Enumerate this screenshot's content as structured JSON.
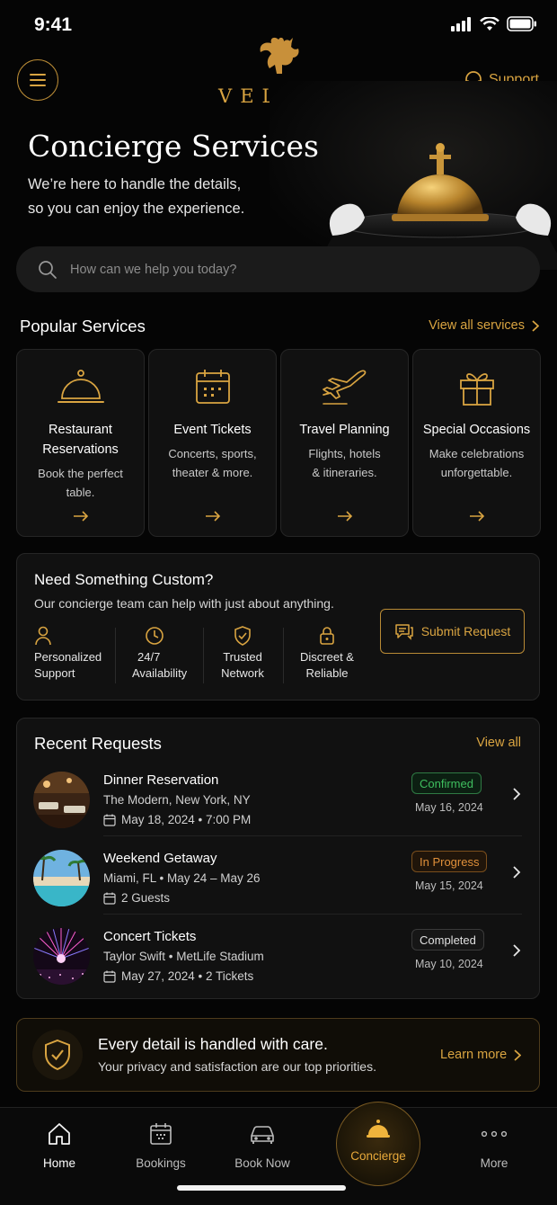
{
  "status": {
    "time": "9:41"
  },
  "brand": {
    "name": "VELTRÉ"
  },
  "header": {
    "support_label": "Support"
  },
  "hero": {
    "title": "Concierge Services",
    "subtitle_line1": "We’re here to handle the details,",
    "subtitle_line2": "so you can enjoy the experience."
  },
  "search": {
    "placeholder": "How can we help you today?"
  },
  "popular": {
    "title": "Popular Services",
    "view_all": "View all services",
    "items": [
      {
        "title_l1": "Restaurant",
        "title_l2": "Reservations",
        "desc_l1": "Book the perfect",
        "desc_l2": "table.",
        "icon": "cloche-icon"
      },
      {
        "title_l1": "Event Tickets",
        "title_l2": "",
        "desc_l1": "Concerts, sports,",
        "desc_l2": "theater & more.",
        "icon": "calendar-icon"
      },
      {
        "title_l1": "Travel Planning",
        "title_l2": "",
        "desc_l1": "Flights, hotels",
        "desc_l2": "& itineraries.",
        "icon": "airplane-icon"
      },
      {
        "title_l1": "Special Occasions",
        "title_l2": "",
        "desc_l1": "Make celebrations",
        "desc_l2": "unforgettable.",
        "icon": "gift-icon"
      }
    ]
  },
  "custom": {
    "title": "Need Something Custom?",
    "subtitle": "Our concierge team can help with just about anything.",
    "features": [
      {
        "l1": "Personalized",
        "l2": "Support",
        "icon": "person-icon"
      },
      {
        "l1": "24/7",
        "l2": "Availability",
        "icon": "clock-icon"
      },
      {
        "l1": "Trusted",
        "l2": "Network",
        "icon": "shield-check-icon"
      },
      {
        "l1": "Discreet &",
        "l2": "Reliable",
        "icon": "lock-icon"
      }
    ],
    "submit_label": "Submit Request"
  },
  "recent": {
    "title": "Recent Requests",
    "view_all": "View all",
    "items": [
      {
        "title": "Dinner Reservation",
        "line1": "The Modern, New York, NY",
        "line2": "May 18, 2024 • 7:00 PM",
        "status": "Confirmed",
        "date": "May 16, 2024",
        "status_color": "#3fbf5f"
      },
      {
        "title": "Weekend Getaway",
        "line1": "Miami, FL • May 24 – May 26",
        "line2": "2 Guests",
        "status": "In Progress",
        "date": "May 15, 2024",
        "status_color": "#e0903a"
      },
      {
        "title": "Concert Tickets",
        "line1": "Taylor Swift • MetLife Stadium",
        "line2": "May 27, 2024 • 2 Tickets",
        "status": "Completed",
        "date": "May 10, 2024",
        "status_color": "#d8d8d8"
      }
    ]
  },
  "care": {
    "title": "Every detail is handled with care.",
    "subtitle": "Your privacy and satisfaction are our top priorities.",
    "link": "Learn more"
  },
  "tabs": [
    {
      "label": "Home",
      "icon": "home-icon"
    },
    {
      "label": "Bookings",
      "icon": "calendar-icon"
    },
    {
      "label": "Book Now",
      "icon": "car-icon"
    },
    {
      "label": "Concierge",
      "icon": "bell-icon"
    },
    {
      "label": "More",
      "icon": "more-icon"
    }
  ],
  "colors": {
    "accent": "#d9a441",
    "background": "#050505",
    "card": "#111111"
  }
}
